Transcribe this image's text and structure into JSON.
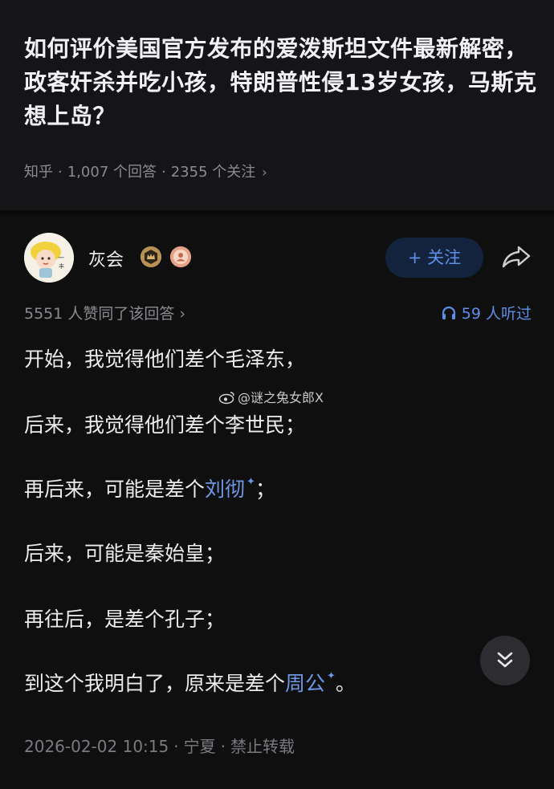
{
  "question": {
    "title": "如何评价美国官方发布的爱泼斯坦文件最新解密，政客奸杀并吃小孩，特朗普性侵13岁女孩，马斯克想上岛？",
    "source": "知乎",
    "answers_count": "1,007 个回答",
    "followers_count": "2355 个关注"
  },
  "author": {
    "name": "灰会",
    "follow_label": "+ 关注"
  },
  "stats": {
    "agree_text": "5551 人赞同了该回答",
    "listen_text": "59 人听过"
  },
  "answer": {
    "p1": "开始，我觉得他们差个毛泽东，",
    "p2": "后来，我觉得他们差个李世民；",
    "p3_before": "再后来，可能是差个",
    "p3_link": "刘彻",
    "p3_after": "；",
    "p4": "后来，可能是秦始皇；",
    "p5": "再往后，是差个孔子；",
    "p6_before": "到这个我明白了，原来是差个",
    "p6_link": "周公",
    "p6_after": "。"
  },
  "watermark": "@谜之兔女郎X",
  "footer": {
    "date": "2026-02-02 10:15",
    "location": "宁夏",
    "copyright": "禁止转载"
  },
  "colors": {
    "background": "#0f0f10",
    "accent_blue": "#5d8fe8",
    "link_blue": "#6e98e6",
    "muted_text": "#8a8a90"
  }
}
